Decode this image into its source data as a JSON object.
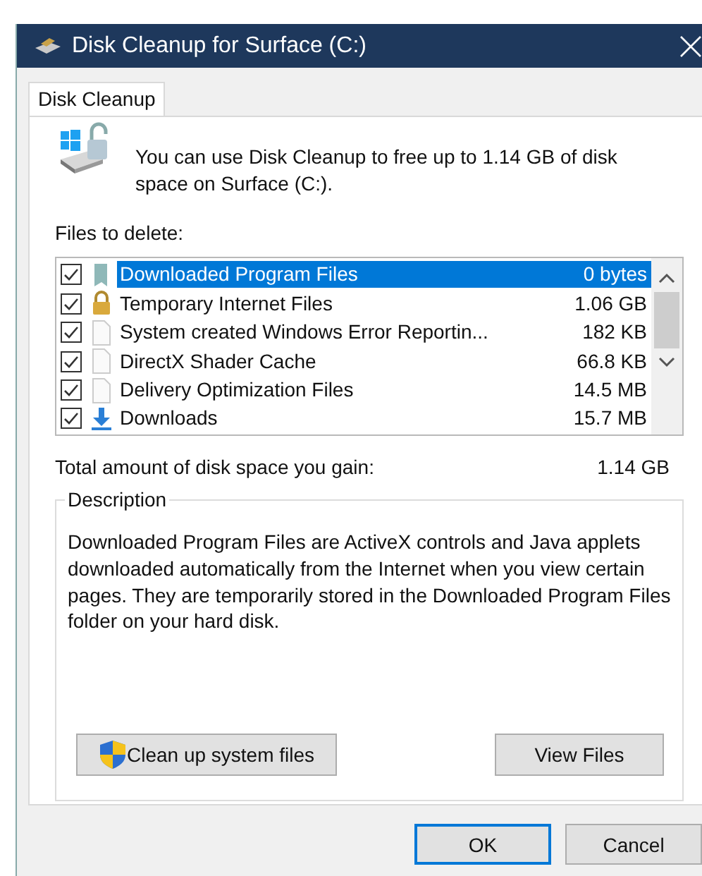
{
  "window": {
    "title": "Disk Cleanup for Surface (C:)"
  },
  "tabs": [
    {
      "label": "Disk Cleanup",
      "selected": true
    }
  ],
  "intro": "You can use Disk Cleanup to free up to 1.14 GB of disk space on Surface (C:).",
  "files_label": "Files to delete:",
  "files": [
    {
      "name": "Downloaded Program Files",
      "size": "0 bytes",
      "checked": true,
      "selected": true,
      "kind": "folder"
    },
    {
      "name": "Temporary Internet Files",
      "size": "1.06 GB",
      "checked": true,
      "selected": false,
      "kind": "lock"
    },
    {
      "name": "System created Windows Error Reportin...",
      "size": "182 KB",
      "checked": true,
      "selected": false,
      "kind": "file"
    },
    {
      "name": "DirectX Shader Cache",
      "size": "66.8 KB",
      "checked": true,
      "selected": false,
      "kind": "file"
    },
    {
      "name": "Delivery Optimization Files",
      "size": "14.5 MB",
      "checked": true,
      "selected": false,
      "kind": "file"
    },
    {
      "name": "Downloads",
      "size": "15.7 MB",
      "checked": true,
      "selected": false,
      "kind": "download"
    }
  ],
  "total": {
    "label": "Total amount of disk space you gain:",
    "value": "1.14 GB"
  },
  "description": {
    "legend": "Description",
    "text": "Downloaded Program Files are ActiveX controls and Java applets downloaded automatically from the Internet when you view certain pages. They are temporarily stored in the Downloaded Program Files folder on your hard disk."
  },
  "panel_buttons": [
    "Clean up system files",
    "View Files"
  ],
  "dialog_buttons": [
    {
      "label": "OK",
      "default": true
    },
    {
      "label": "Cancel",
      "default": false
    }
  ]
}
